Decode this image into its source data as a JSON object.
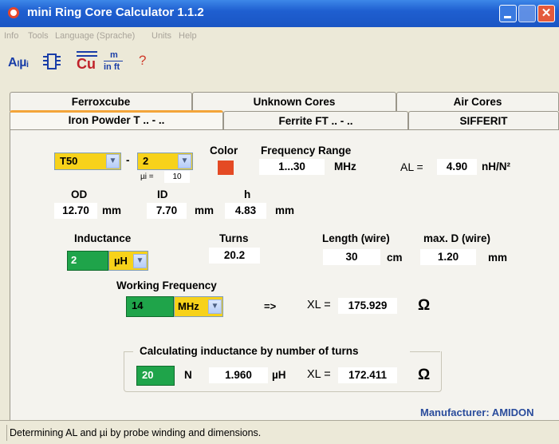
{
  "window": {
    "title": "mini Ring Core Calculator 1.1.2",
    "close_glyph": "✕"
  },
  "menu": [
    "Info",
    "Tools",
    "Language (Sprache)",
    "Units",
    "Help"
  ],
  "toolbar": {
    "al_mu_icon": "Aₗµᵢ",
    "cu_icon": "Cu",
    "m_label": "m",
    "inft_label": "in ft",
    "help_icon": "?"
  },
  "tabs": {
    "row1": [
      "Ferroxcube",
      "Unknown Cores",
      "Air Cores"
    ],
    "row2": [
      "Iron Powder T .. - ..",
      "Ferrite FT .. - ..",
      "SIFFERIT"
    ]
  },
  "core": {
    "type": "T50",
    "dash": "-",
    "mix": "2",
    "mu_label": "µi =",
    "mu_value": "10"
  },
  "color": {
    "label": "Color",
    "swatch": "#e44a24"
  },
  "frequency_range": {
    "label": "Frequency Range",
    "value": "1...30",
    "unit": "MHz"
  },
  "al": {
    "label": "AL =",
    "value": "4.90",
    "unit": "nH/N²"
  },
  "dims": {
    "od_label": "OD",
    "od_value": "12.70",
    "od_unit": "mm",
    "id_label": "ID",
    "id_value": "7.70",
    "id_unit": "mm",
    "h_label": "h",
    "h_value": "4.83",
    "h_unit": "mm"
  },
  "inductance": {
    "label": "Inductance",
    "value": "2",
    "unit": "µH"
  },
  "turns": {
    "label": "Turns",
    "value": "20.2"
  },
  "length": {
    "label": "Length (wire)",
    "value": "30",
    "unit": "cm"
  },
  "diameter": {
    "label": "max. D (wire)",
    "value": "1.20",
    "unit": "mm"
  },
  "working": {
    "label": "Working Frequency",
    "value": "14",
    "unit": "MHz",
    "arrow": "=>",
    "xl_label": "XL =",
    "xl_value": "175.929",
    "ohm": "Ω"
  },
  "calc": {
    "legend": "Calculating inductance by number of turns",
    "turns": "20",
    "n_label": "N",
    "l_value": "1.960",
    "l_unit": "µH",
    "xl_label": "XL =",
    "xl_value": "172.411",
    "ohm": "Ω"
  },
  "manufacturer": "Manufacturer: AMIDON",
  "status": "Determining AL and µi by probe winding and dimensions.",
  "colors": {
    "green": "#1fa44a",
    "yellow": "#f7d21a",
    "accent": "#2a4c9c"
  }
}
